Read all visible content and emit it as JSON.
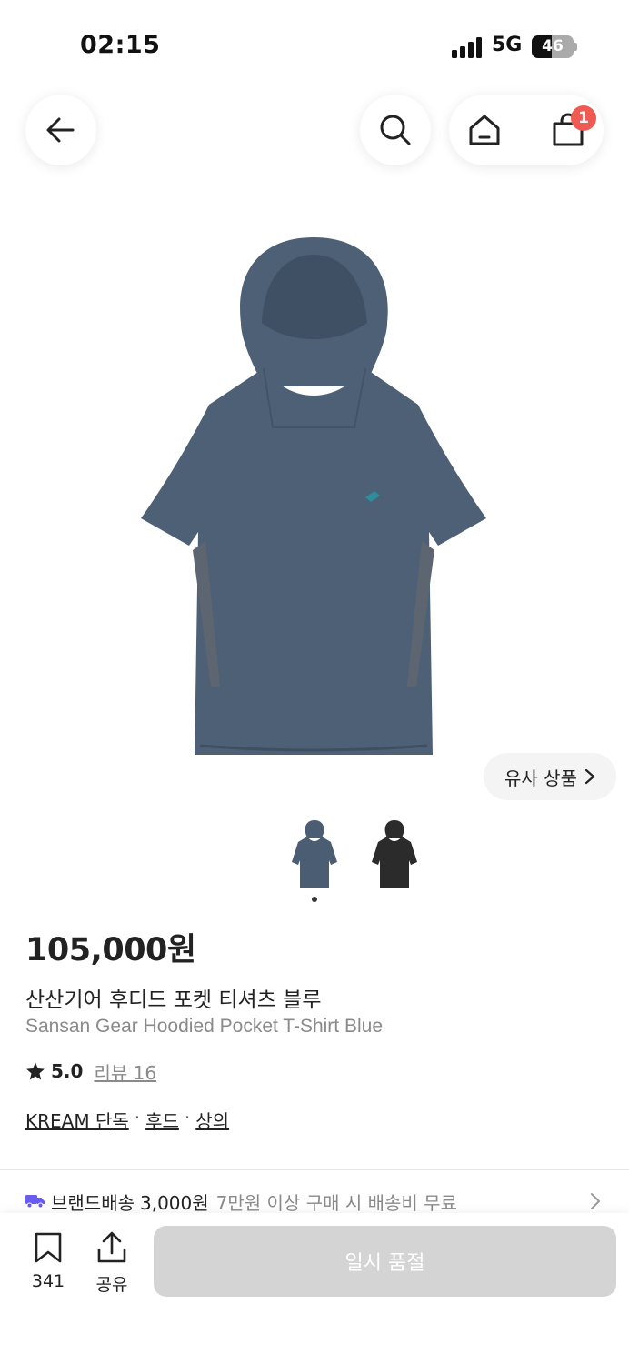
{
  "status_bar": {
    "time": "02:15",
    "network": "5G",
    "battery": "46"
  },
  "nav": {
    "cart_badge": "1"
  },
  "product": {
    "similar_label": "유사 상품",
    "price": "105,000원",
    "name_ko": "산산기어 후디드 포켓 티셔츠 블루",
    "name_en": "Sansan Gear Hoodied Pocket T-Shirt Blue",
    "rating": "5.0",
    "review_label": "리뷰 16",
    "categories": [
      "KREAM 단독",
      "후드",
      "상의"
    ],
    "variant_colors": [
      "#4a5d72",
      "#2b2b2b"
    ],
    "image_color": "#4d6076"
  },
  "shipping": {
    "label": "브랜드배송",
    "fee": "3,000원",
    "condition": "7만원 이상 구매 시 배송비 무료"
  },
  "bottom_bar": {
    "bookmark_count": "341",
    "share_label": "공유",
    "buy_label": "일시 품절"
  }
}
